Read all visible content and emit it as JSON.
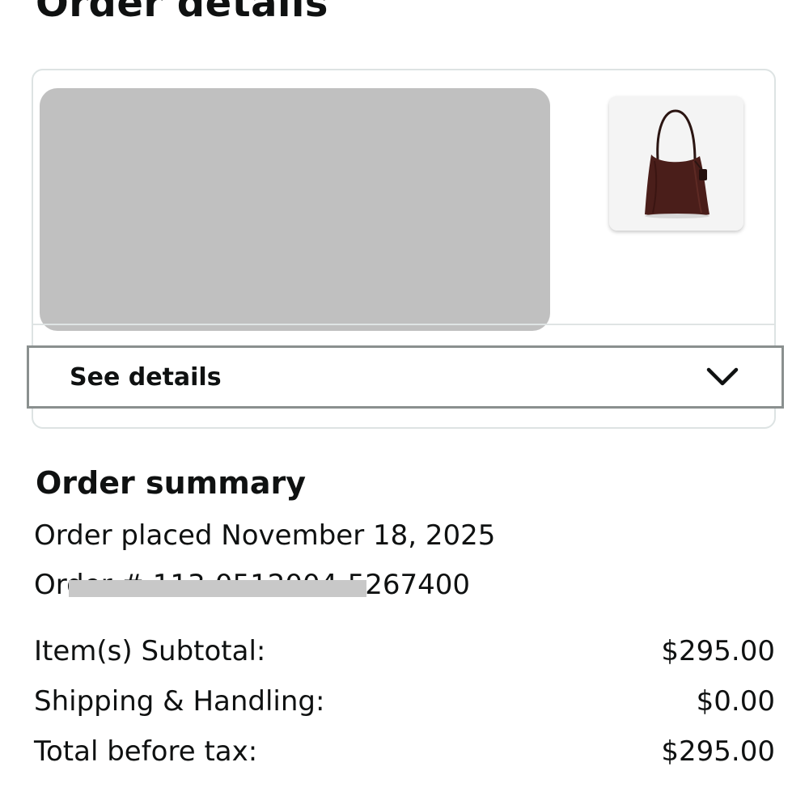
{
  "page": {
    "title": "Order details"
  },
  "item_card": {
    "product_image": "hobo-shoulder-bag",
    "see_details_label": "See details",
    "chevron_icon": "chevron-down-icon"
  },
  "order_summary": {
    "title": "Order summary",
    "placed_text": "Order placed November 18, 2025",
    "order_number_text": "Order # 113-0512004-5267400",
    "rows": [
      {
        "label": "Item(s) Subtotal:",
        "value": "$295.00"
      },
      {
        "label": "Shipping & Handling:",
        "value": "$0.00"
      },
      {
        "label": "Total before tax:",
        "value": "$295.00"
      }
    ]
  },
  "colors": {
    "text": "#0f1111",
    "redacted": "#c0c0c0",
    "card_border": "#dde3e3",
    "focus_border": "#8a908f",
    "bag_brown": "#4a1e1a"
  }
}
